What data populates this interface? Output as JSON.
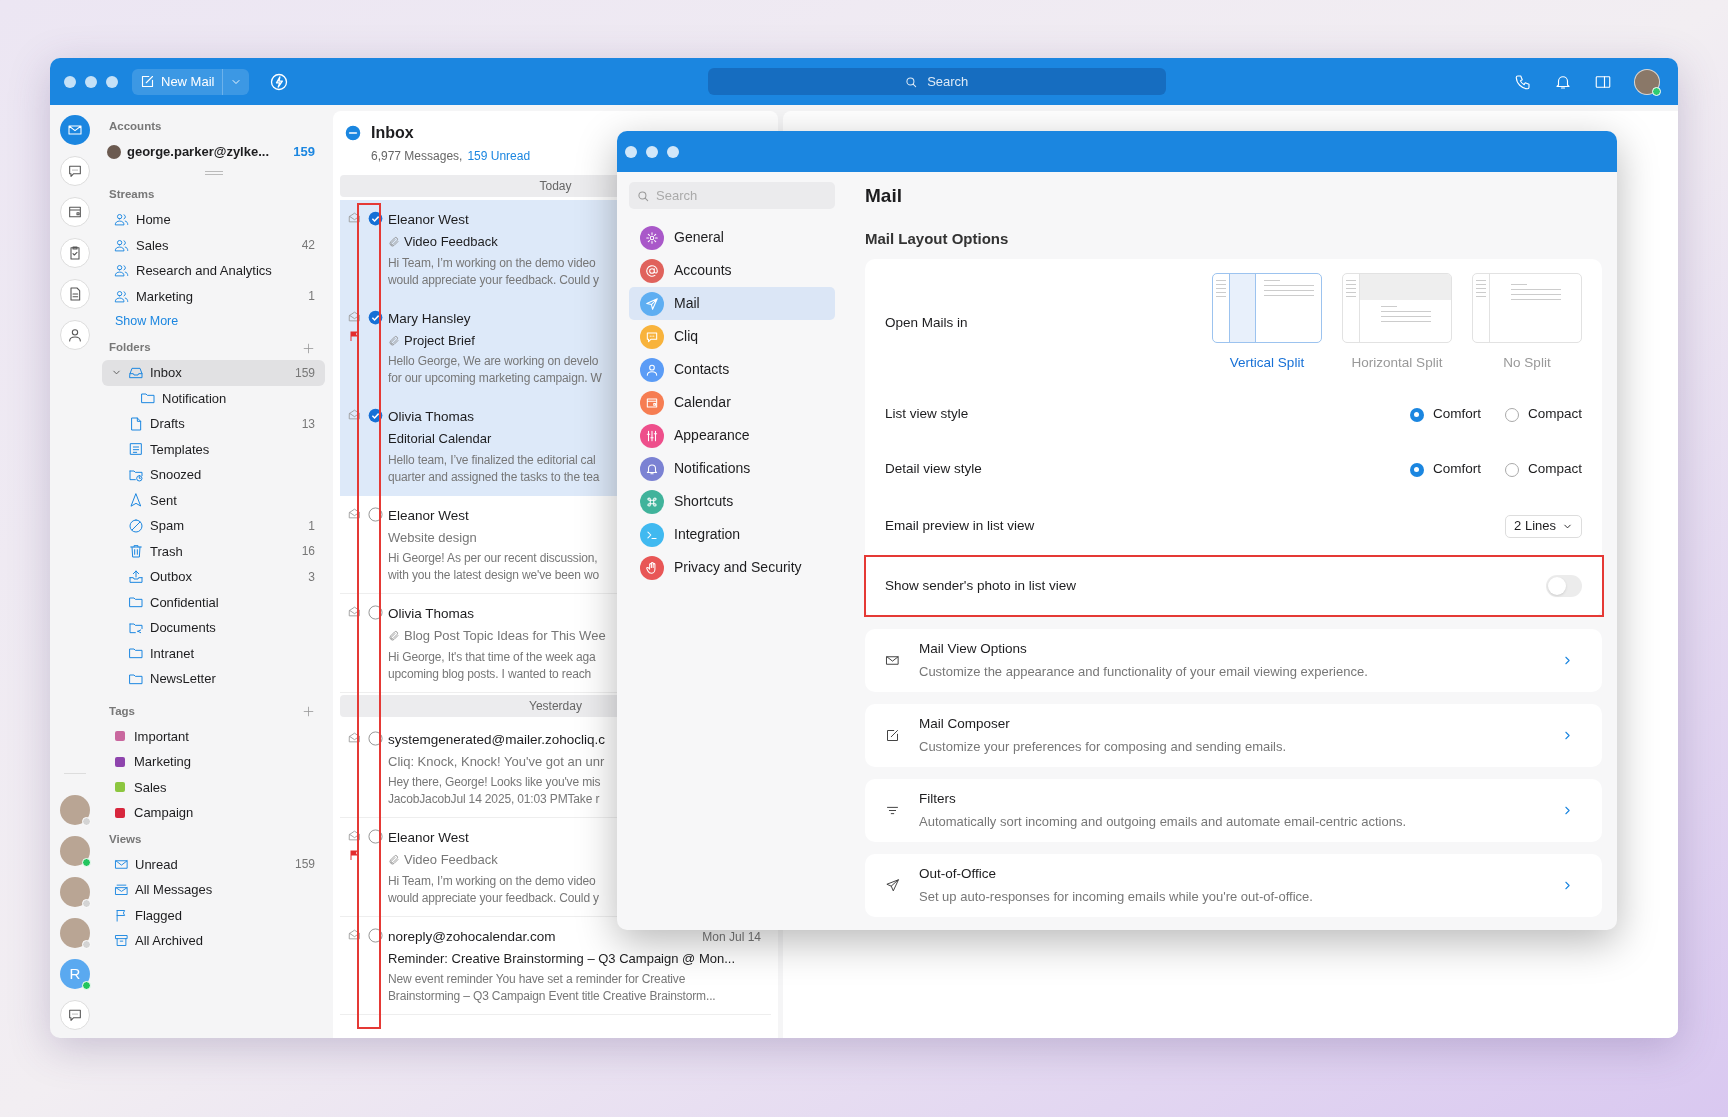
{
  "top_bar": {
    "new_mail": "New Mail",
    "search_placeholder": "Search"
  },
  "rail": {
    "apps": [
      {
        "kind": "mail",
        "selected": true
      },
      {
        "kind": "chat",
        "selected": false
      },
      {
        "kind": "wallet",
        "selected": false
      },
      {
        "kind": "tasks",
        "selected": false
      },
      {
        "kind": "notes",
        "selected": false
      },
      {
        "kind": "contacts",
        "selected": false
      }
    ],
    "people": [
      {
        "kind": "photo",
        "online": false
      },
      {
        "kind": "photo",
        "online": true
      },
      {
        "kind": "photo",
        "online": false
      },
      {
        "kind": "photo",
        "online": false
      },
      {
        "kind": "initial",
        "initial": "R",
        "online": true
      }
    ]
  },
  "sidebar": {
    "accounts_label": "Accounts",
    "account": {
      "email": "george.parker@zylke...",
      "count": "159"
    },
    "streams_label": "Streams",
    "streams": [
      {
        "name": "Home"
      },
      {
        "name": "Sales",
        "count": "42"
      },
      {
        "name": "Research and Analytics"
      },
      {
        "name": "Marketing",
        "count": "1"
      }
    ],
    "show_more": "Show More",
    "folders_label": "Folders",
    "folders": [
      {
        "name": "Inbox",
        "kind": "inbox",
        "count": "159",
        "selected": true,
        "expanded": true,
        "children": [
          {
            "name": "Notification",
            "kind": "folder",
            "selected": false
          }
        ]
      },
      {
        "name": "Drafts",
        "kind": "draft",
        "count": "13",
        "selected": false
      },
      {
        "name": "Templates",
        "kind": "template",
        "selected": false
      },
      {
        "name": "Snoozed",
        "kind": "snoozed",
        "selected": false
      },
      {
        "name": "Sent",
        "kind": "sent",
        "selected": false
      },
      {
        "name": "Spam",
        "kind": "spam",
        "count": "1",
        "selected": false
      },
      {
        "name": "Trash",
        "kind": "trash",
        "count": "16",
        "selected": false
      },
      {
        "name": "Outbox",
        "kind": "outbox",
        "count": "3",
        "selected": false
      },
      {
        "name": "Confidential",
        "kind": "folder",
        "selected": false
      },
      {
        "name": "Documents",
        "kind": "shared",
        "selected": false
      },
      {
        "name": "Intranet",
        "kind": "folder",
        "selected": false
      },
      {
        "name": "NewsLetter",
        "kind": "folder",
        "selected": false
      }
    ],
    "tags_label": "Tags",
    "tags": [
      {
        "name": "Important",
        "color": "#c9679e"
      },
      {
        "name": "Marketing",
        "color": "#8e44ad"
      },
      {
        "name": "Sales",
        "color": "#8cc63f"
      },
      {
        "name": "Campaign",
        "color": "#d7263d"
      }
    ],
    "views_label": "Views",
    "views": [
      {
        "name": "Unread",
        "kind": "unread",
        "count": "159"
      },
      {
        "name": "All Messages",
        "kind": "all"
      },
      {
        "name": "Flagged",
        "kind": "flag"
      },
      {
        "name": "All Archived",
        "kind": "archive"
      }
    ]
  },
  "message_list": {
    "title": "Inbox",
    "total": "6,977 Messages,",
    "unread": "159 Unread",
    "groups": [
      {
        "label": "Today",
        "messages": [
          {
            "sender": "Eleanor West",
            "subject": "Video Feedback",
            "attachment": true,
            "unread": true,
            "flagged": false,
            "selected": true,
            "preview": [
              "Hi Team, I’m working on the demo video",
              "would appreciate your feedback. Could y"
            ]
          },
          {
            "sender": "Mary Hansley",
            "subject": "Project Brief",
            "attachment": true,
            "unread": true,
            "flagged": true,
            "selected": true,
            "preview": [
              "Hello George, We are working on develo",
              "for our upcoming marketing campaign. W"
            ]
          },
          {
            "sender": "Olivia Thomas",
            "subject": "Editorial Calendar",
            "attachment": false,
            "unread": true,
            "flagged": false,
            "selected": true,
            "preview": [
              "Hello team, I’ve finalized the editorial cal",
              "quarter and assigned the tasks to the tea"
            ]
          },
          {
            "sender": "Eleanor West",
            "subject": "Website design",
            "attachment": false,
            "unread": false,
            "flagged": false,
            "selected": false,
            "preview": [
              "Hi George! As per our recent discussion,",
              "with you the latest design we've been wo"
            ]
          },
          {
            "sender": "Olivia Thomas",
            "subject": "Blog Post Topic Ideas for This Wee",
            "attachment": true,
            "unread": false,
            "flagged": false,
            "selected": false,
            "preview": [
              "Hi George, It's that time of the week aga",
              "upcoming blog posts. I wanted to reach"
            ]
          }
        ]
      },
      {
        "label": "Yesterday",
        "messages": [
          {
            "sender": "systemgenerated@mailer.zohocliq.c",
            "subject": "Cliq: Knock, Knock! You've got an unr",
            "attachment": false,
            "unread": false,
            "flagged": false,
            "selected": false,
            "preview": [
              "Hey there, George! Looks like you've mis",
              "JacobJacobJul 14 2025, 01:03 PMTake r"
            ]
          },
          {
            "sender": "Eleanor West",
            "subject": "Video Feedback",
            "attachment": true,
            "unread": false,
            "flagged": true,
            "selected": false,
            "preview": [
              "Hi Team, I’m working on the demo video",
              "would appreciate your feedback. Could y"
            ]
          },
          {
            "sender": "noreply@zohocalendar.com",
            "subject": "Reminder: Creative Brainstorming – Q3 Campaign @ Mon...",
            "attachment": false,
            "unread": true,
            "flagged": false,
            "selected": false,
            "date": "Mon Jul 14",
            "preview": [
              "New event reminder You have set a reminder for Creative",
              "Brainstorming – Q3 Campaign Event title Creative Brainstorm..."
            ]
          }
        ]
      }
    ]
  },
  "settings": {
    "search_placeholder": "Search",
    "nav": [
      {
        "label": "General",
        "kind": "gear",
        "color": "#a958c9",
        "selected": false
      },
      {
        "label": "Accounts",
        "kind": "at",
        "color": "#e0625c",
        "selected": false
      },
      {
        "label": "Mail",
        "kind": "send",
        "color": "#5eaef2",
        "selected": true
      },
      {
        "label": "Cliq",
        "kind": "chat",
        "color": "#f8b33c",
        "selected": false
      },
      {
        "label": "Contacts",
        "kind": "person",
        "color": "#5b9cf6",
        "selected": false
      },
      {
        "label": "Calendar",
        "kind": "wallet",
        "color": "#f67d52",
        "selected": false
      },
      {
        "label": "Appearance",
        "kind": "sliders",
        "color": "#ee4f8b",
        "selected": false
      },
      {
        "label": "Notifications",
        "kind": "bell",
        "color": "#7b82d3",
        "selected": false
      },
      {
        "label": "Shortcuts",
        "kind": "command",
        "color": "#40b39b",
        "selected": false
      },
      {
        "label": "Integration",
        "kind": "terminal",
        "color": "#40b9f0",
        "selected": false
      },
      {
        "label": "Privacy and Security",
        "kind": "hand",
        "color": "#e85656",
        "selected": false
      }
    ],
    "title": "Mail",
    "section": "Mail Layout Options",
    "open_mails": {
      "label": "Open Mails in",
      "options": [
        {
          "label": "Vertical Split",
          "kind": "vertical",
          "selected": true
        },
        {
          "label": "Horizontal Split",
          "kind": "horizontal",
          "selected": false
        },
        {
          "label": "No Split",
          "kind": "none",
          "selected": false
        }
      ]
    },
    "radio_rows": [
      {
        "label": "List view style",
        "options": [
          {
            "label": "Comfort",
            "selected": true
          },
          {
            "label": "Compact",
            "selected": false
          }
        ]
      },
      {
        "label": "Detail view style",
        "options": [
          {
            "label": "Comfort",
            "selected": true
          },
          {
            "label": "Compact",
            "selected": false
          }
        ]
      }
    ],
    "preview": {
      "label": "Email preview in list view",
      "value": "2 Lines"
    },
    "photo_toggle": {
      "label": "Show sender's photo in list view",
      "on": false
    },
    "links": [
      {
        "kind": "envelope",
        "title": "Mail View Options",
        "description": "Customize the appearance and functionality of your email viewing experience."
      },
      {
        "kind": "compose",
        "title": "Mail Composer",
        "description": "Customize your preferences for composing and sending emails."
      },
      {
        "kind": "filter",
        "title": "Filters",
        "description": "Automatically sort incoming and outgoing emails and automate email-centric actions."
      },
      {
        "kind": "plane",
        "title": "Out-of-Office",
        "description": "Set up auto-responses for incoming emails while you're out-of-office."
      }
    ]
  }
}
